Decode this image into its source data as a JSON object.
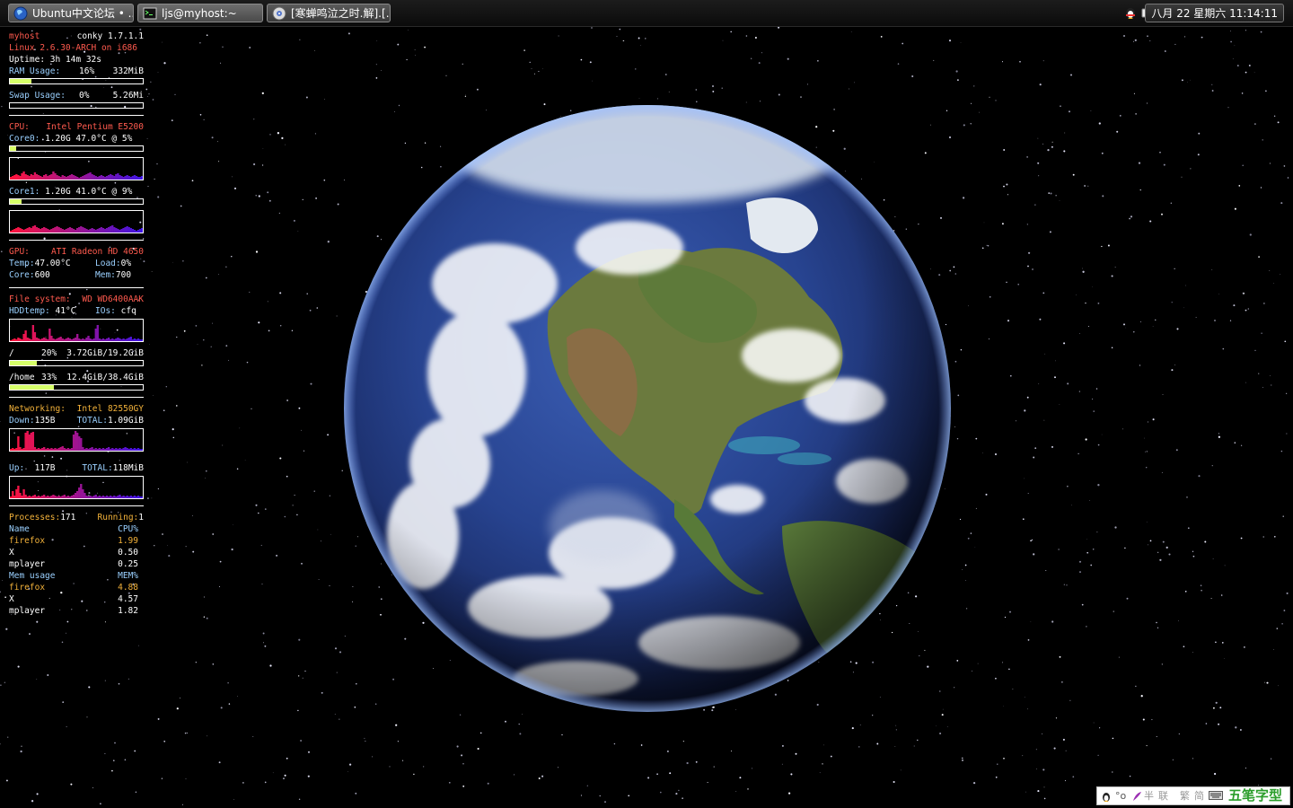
{
  "taskbar": {
    "tasks": [
      {
        "label": "Ubuntu中文论坛 • ...",
        "icon": "globe-icon"
      },
      {
        "label": "ljs@myhost:~",
        "icon": "terminal-icon"
      },
      {
        "label": "[寒蝉鸣泣之时.解].[…",
        "icon": "media-player-icon"
      }
    ],
    "tray": {
      "icons": [
        "qq-penguin-icon",
        "input-method-icon",
        "volume-icon"
      ]
    },
    "clock": "八月 22 星期六 11:14:11"
  },
  "conky": {
    "host": "myhost",
    "version": "conky 1.7.1.1",
    "kernel": "Linux 2.6.30-ARCH on i686",
    "uptime_label": "Uptime:",
    "uptime": "3h 14m 32s",
    "ram": {
      "label": "RAM Usage:",
      "percent": "16%",
      "amount": "332MiB",
      "fraction": 0.16
    },
    "swap": {
      "label": "Swap Usage:",
      "percent": "0%",
      "amount": "5.26Mi",
      "fraction": 0.0
    },
    "cpu": {
      "label": "CPU:",
      "model": "Intel Pentium E5200",
      "cores": [
        {
          "label": "Core0:",
          "info": "1.20G 47.0°C @ 5%",
          "fraction": 0.05
        },
        {
          "label": "Core1:",
          "info": "1.20G 41.0°C @ 9%",
          "fraction": 0.09
        }
      ]
    },
    "gpu": {
      "label": "GPU:",
      "model": "ATI Radeon HD 4650",
      "temp_label": "Temp:",
      "temp": "47.00°C",
      "load_label": "Load:",
      "load": "0%",
      "core_label": "Core:",
      "core": "600",
      "mem_label": "Mem:",
      "mem": "700"
    },
    "fs": {
      "label": "File system:",
      "model": "WD WD6400AAK",
      "hddtemp_label": "HDDtemp:",
      "hddtemp": "41°C",
      "ios_label": "IOs:",
      "ios": "cfq",
      "mounts": [
        {
          "path": "/",
          "percent": "20%",
          "usage": "3.72GiB/19.2GiB",
          "fraction": 0.2
        },
        {
          "path": "/home",
          "percent": "33%",
          "usage": "12.4GiB/38.4GiB",
          "fraction": 0.33
        }
      ]
    },
    "net": {
      "label": "Networking:",
      "model": "Intel 82550GY",
      "down_label": "Down:",
      "down": "135B",
      "down_total_label": "TOTAL:",
      "down_total": "1.09GiB",
      "up_label": "Up:",
      "up": "117B",
      "up_total_label": "TOTAL:",
      "up_total": "118MiB"
    },
    "proc": {
      "label": "Processes:",
      "count": "171",
      "running_label": "Running:",
      "running": "1",
      "cpu_header": {
        "name": "Name",
        "val": "CPU%"
      },
      "cpu_rows": [
        {
          "name": " firefox",
          "val": "1.99"
        },
        {
          "name": " X",
          "val": "0.50"
        },
        {
          "name": " mplayer",
          "val": "0.25"
        }
      ],
      "mem_header": {
        "name": "Mem usage",
        "val": "MEM%"
      },
      "mem_rows": [
        {
          "name": " firefox",
          "val": "4.88"
        },
        {
          "name": " X",
          "val": "4.57"
        },
        {
          "name": " mplayer",
          "val": "1.82"
        }
      ]
    }
  },
  "ime": {
    "label": "五笔字型",
    "indicators": [
      "半",
      "联",
      "繁",
      "简"
    ]
  },
  "colors": {
    "conky_label": "#9ad0ff",
    "conky_heading": "#ff5a4e",
    "conky_accent": "#f3b23a",
    "bar_fill": "#d6ff69",
    "ime_green": "#2a9d2a"
  }
}
